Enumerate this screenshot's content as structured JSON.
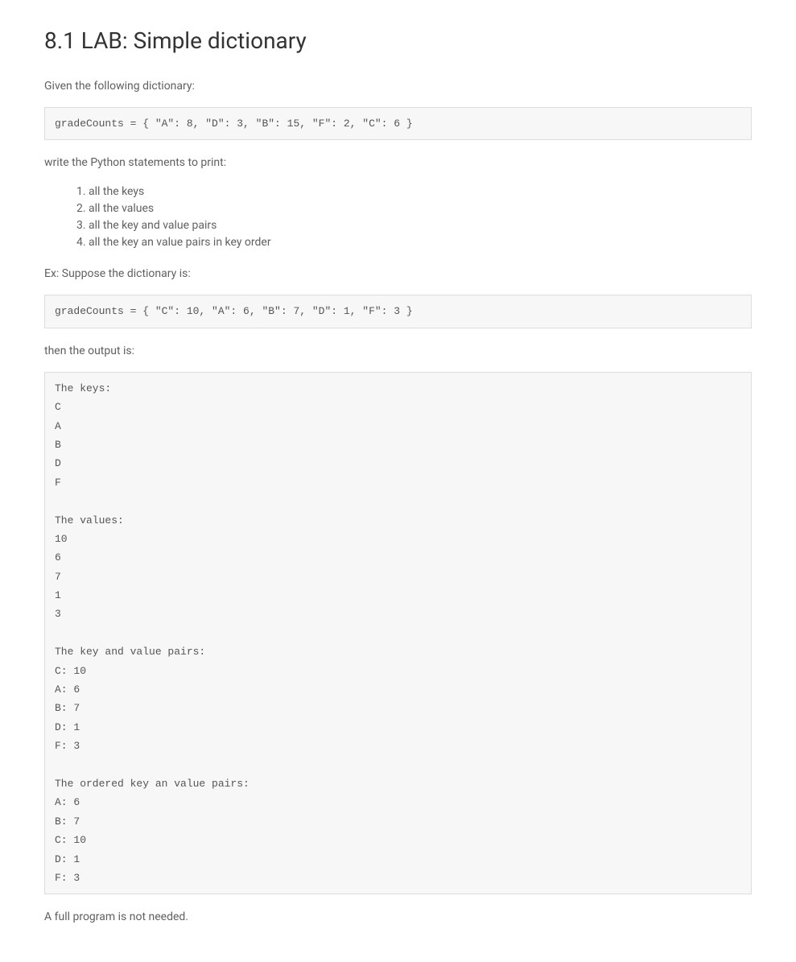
{
  "heading": "8.1 LAB: Simple dictionary",
  "intro": "Given the following dictionary:",
  "code1": "gradeCounts = { \"A\": 8, \"D\": 3, \"B\": 15, \"F\": 2, \"C\": 6 }",
  "instruction": "write the Python statements to print:",
  "listItems": {
    "i1": "all the keys",
    "i2": "all the values",
    "i3": "all the key and value pairs",
    "i4": "all the key an value pairs in key order"
  },
  "exampleLabel": "Ex: Suppose the dictionary is:",
  "code2": "gradeCounts = { \"C\": 10, \"A\": 6, \"B\": 7, \"D\": 1, \"F\": 3 }",
  "outputLabel": "then the output is:",
  "output": "The keys:\nC\nA\nB\nD\nF\n\nThe values:\n10\n6\n7\n1\n3\n\nThe key and value pairs:\nC: 10\nA: 6\nB: 7\nD: 1\nF: 3\n\nThe ordered key an value pairs:\nA: 6\nB: 7\nC: 10\nD: 1\nF: 3",
  "footer": "A full program is not needed."
}
